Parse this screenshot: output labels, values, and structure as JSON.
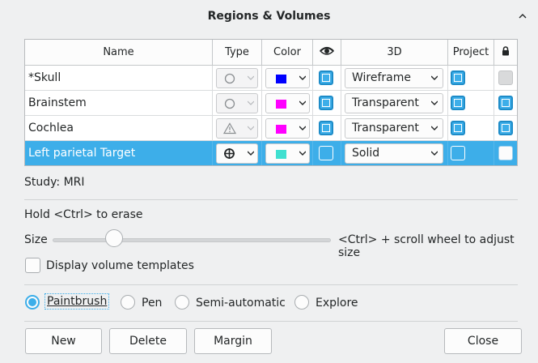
{
  "window": {
    "title": "Regions & Volumes"
  },
  "table": {
    "headers": [
      "Name",
      "Type",
      "Color",
      "",
      "3D",
      "Project",
      ""
    ],
    "rows": [
      {
        "name": "*Skull",
        "type_icon": "circle-outline-icon",
        "color": "#0000ff",
        "visible": true,
        "render": "Wireframe",
        "project": true,
        "locked": false
      },
      {
        "name": "Brainstem",
        "type_icon": "circle-outline-icon",
        "color": "#ff00ff",
        "visible": true,
        "render": "Transparent",
        "project": true,
        "locked": true
      },
      {
        "name": "Cochlea",
        "type_icon": "warning-triangle-icon",
        "color": "#ff00ff",
        "visible": true,
        "render": "Transparent",
        "project": true,
        "locked": true
      },
      {
        "name": "Left parietal Target",
        "type_icon": "crosshair-icon",
        "color": "#40e0d0",
        "visible": false,
        "render": "Solid",
        "project": false,
        "locked": false
      }
    ]
  },
  "study": {
    "label": "Study:",
    "value": "MRI"
  },
  "brush": {
    "hint": "Hold <Ctrl> to erase",
    "size_label": "Size",
    "size_value": 0.2,
    "size_hint": "<Ctrl> + scroll wheel to adjust size"
  },
  "display_templates": {
    "label": "Display volume templates",
    "checked": false
  },
  "modes": [
    {
      "label": "Paintbrush",
      "selected": true
    },
    {
      "label": "Pen",
      "selected": false
    },
    {
      "label": "Semi-automatic",
      "selected": false
    },
    {
      "label": "Explore",
      "selected": false
    }
  ],
  "buttons": {
    "new": "New",
    "delete": "Delete",
    "margin": "Margin",
    "close": "Close"
  },
  "colors": {
    "accent": "#3daee9",
    "window_bg": "#eff0f1",
    "selection_text": "#ffffff"
  }
}
